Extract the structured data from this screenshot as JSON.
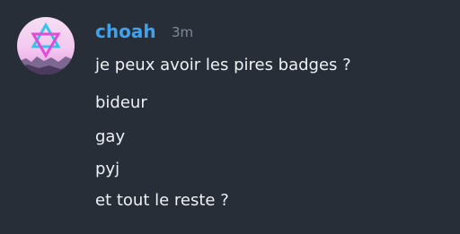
{
  "message": {
    "author": "choah",
    "timestamp": "3m",
    "avatar_icon": "star-of-david-icon",
    "colors": {
      "background": "#272e38",
      "author": "#3ea2ef",
      "timestamp": "#808b98",
      "text": "#eef1f5"
    },
    "lines": [
      "je peux avoir les pires badges ?",
      "bideur",
      "gay",
      "pyj",
      "et tout le reste ?"
    ]
  }
}
